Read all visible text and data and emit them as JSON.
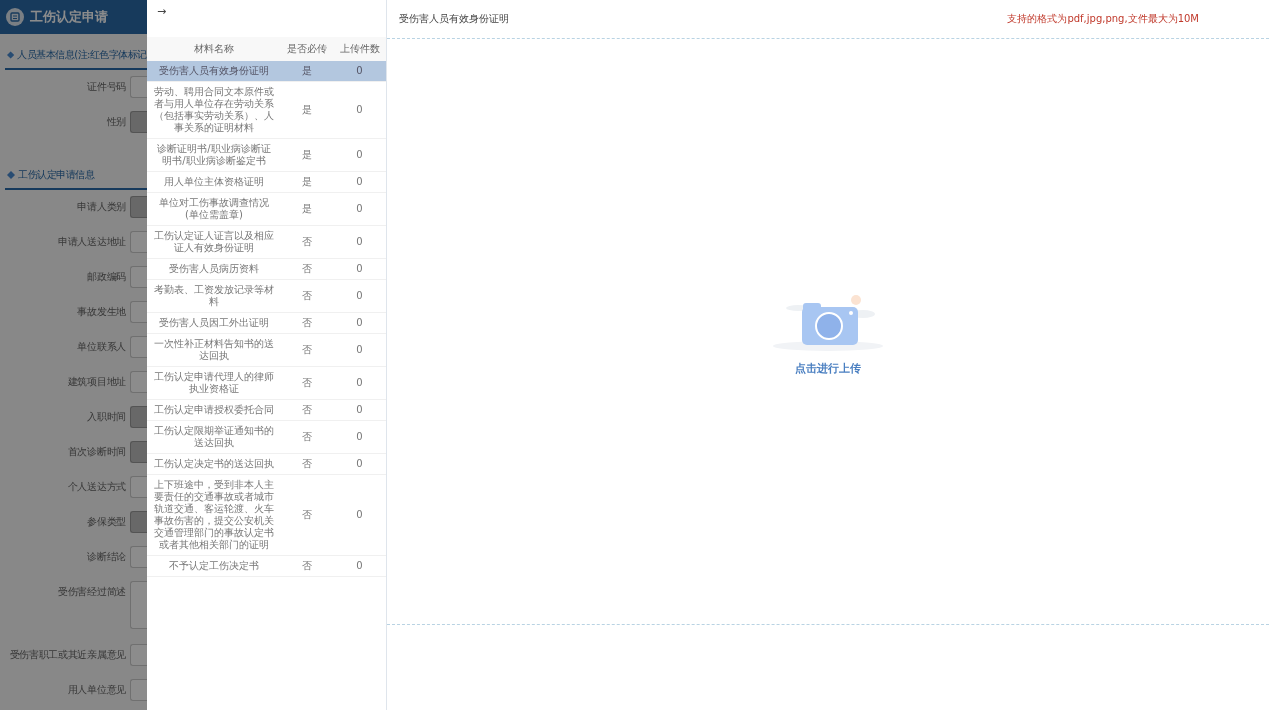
{
  "page": {
    "title": "工伤认定申请",
    "sections": [
      {
        "title": "人员基本信息(注:红色字体标记",
        "fields": [
          {
            "label": "证件号码",
            "kind": "input",
            "disabled": false
          },
          {
            "label": "性别",
            "kind": "input",
            "disabled": true
          }
        ]
      },
      {
        "title": "工伤认定申请信息",
        "fields": [
          {
            "label": "申请人类别",
            "kind": "input",
            "disabled": true
          },
          {
            "label": "申请人送达地址",
            "kind": "input",
            "disabled": false
          },
          {
            "label": "邮政编码",
            "kind": "input",
            "disabled": false
          },
          {
            "label": "事故发生地",
            "kind": "input",
            "disabled": false
          },
          {
            "label": "单位联系人",
            "kind": "input",
            "disabled": false
          },
          {
            "label": "建筑项目地址",
            "kind": "input",
            "disabled": false
          },
          {
            "label": "入职时间",
            "kind": "input",
            "disabled": true
          },
          {
            "label": "首次诊断时间",
            "kind": "input",
            "disabled": true
          },
          {
            "label": "个人送达方式",
            "kind": "input",
            "disabled": false
          },
          {
            "label": "参保类型",
            "kind": "input",
            "disabled": true
          },
          {
            "label": "诊断结论",
            "kind": "input",
            "disabled": false
          },
          {
            "label": "受伤害经过简述",
            "kind": "textarea",
            "disabled": false
          },
          {
            "label": "受伤害职工或其近亲属意见",
            "kind": "input",
            "disabled": false
          },
          {
            "label": "用人单位意见",
            "kind": "input",
            "disabled": false
          }
        ]
      }
    ]
  },
  "drawer": {
    "back_button": "→",
    "table": {
      "columns": [
        "材料名称",
        "是否必传",
        "上传件数"
      ],
      "rows": [
        {
          "name": "受伤害人员有效身份证明",
          "required": "是",
          "count": "0",
          "selected": true
        },
        {
          "name": "劳动、聘用合同文本原件或者与用人单位存在劳动关系（包括事实劳动关系）、人事关系的证明材料",
          "required": "是",
          "count": "0",
          "selected": false
        },
        {
          "name": "诊断证明书/职业病诊断证明书/职业病诊断鉴定书",
          "required": "是",
          "count": "0",
          "selected": false
        },
        {
          "name": "用人单位主体资格证明",
          "required": "是",
          "count": "0",
          "selected": false
        },
        {
          "name": "单位对工伤事故调查情况(单位需盖章)",
          "required": "是",
          "count": "0",
          "selected": false
        },
        {
          "name": "工伤认定证人证言以及相应证人有效身份证明",
          "required": "否",
          "count": "0",
          "selected": false
        },
        {
          "name": "受伤害人员病历资料",
          "required": "否",
          "count": "0",
          "selected": false
        },
        {
          "name": "考勤表、工资发放记录等材料",
          "required": "否",
          "count": "0",
          "selected": false
        },
        {
          "name": "受伤害人员因工外出证明",
          "required": "否",
          "count": "0",
          "selected": false
        },
        {
          "name": "一次性补正材料告知书的送达回执",
          "required": "否",
          "count": "0",
          "selected": false
        },
        {
          "name": "工伤认定申请代理人的律师执业资格证",
          "required": "否",
          "count": "0",
          "selected": false
        },
        {
          "name": "工伤认定申请授权委托合同",
          "required": "否",
          "count": "0",
          "selected": false
        },
        {
          "name": "工伤认定限期举证通知书的送达回执",
          "required": "否",
          "count": "0",
          "selected": false
        },
        {
          "name": "工伤认定决定书的送达回执",
          "required": "否",
          "count": "0",
          "selected": false
        },
        {
          "name": "上下班途中，受到非本人主要责任的交通事故或者城市轨道交通、客运轮渡、火车事故伤害的，提交公安机关交通管理部门的事故认定书或者其他相关部门的证明",
          "required": "否",
          "count": "0",
          "selected": false
        },
        {
          "name": "不予认定工伤决定书",
          "required": "否",
          "count": "0",
          "selected": false
        }
      ]
    },
    "preview": {
      "title": "受伤害人员有效身份证明",
      "note": "支持的格式为pdf,jpg,png,文件最大为10M",
      "upload_label": "点击进行上传"
    }
  }
}
